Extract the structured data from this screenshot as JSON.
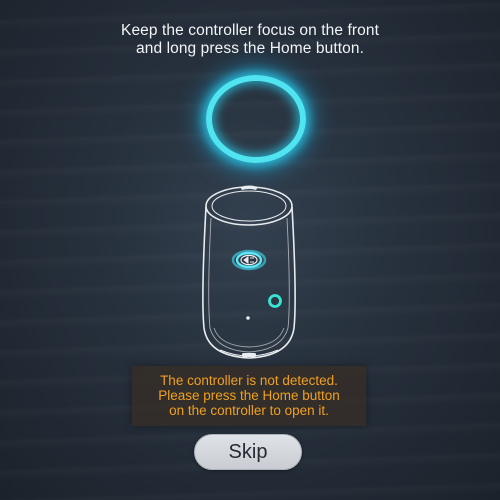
{
  "instruction": {
    "line1": "Keep the controller focus on the front",
    "line2": "and long press the Home button."
  },
  "icons": {
    "focus_ring": "focus-ring-icon",
    "controller": "vr-controller-icon",
    "home_button": "home-button-icon",
    "indicator": "indicator-light-icon"
  },
  "colors": {
    "accent_cyan": "#4fe4f0",
    "warning_orange": "#f0a020"
  },
  "message": {
    "line1": "The controller is not detected.",
    "line2": "Please press the Home button",
    "line3": "on the controller to open it."
  },
  "skip_button": {
    "label": "Skip"
  }
}
